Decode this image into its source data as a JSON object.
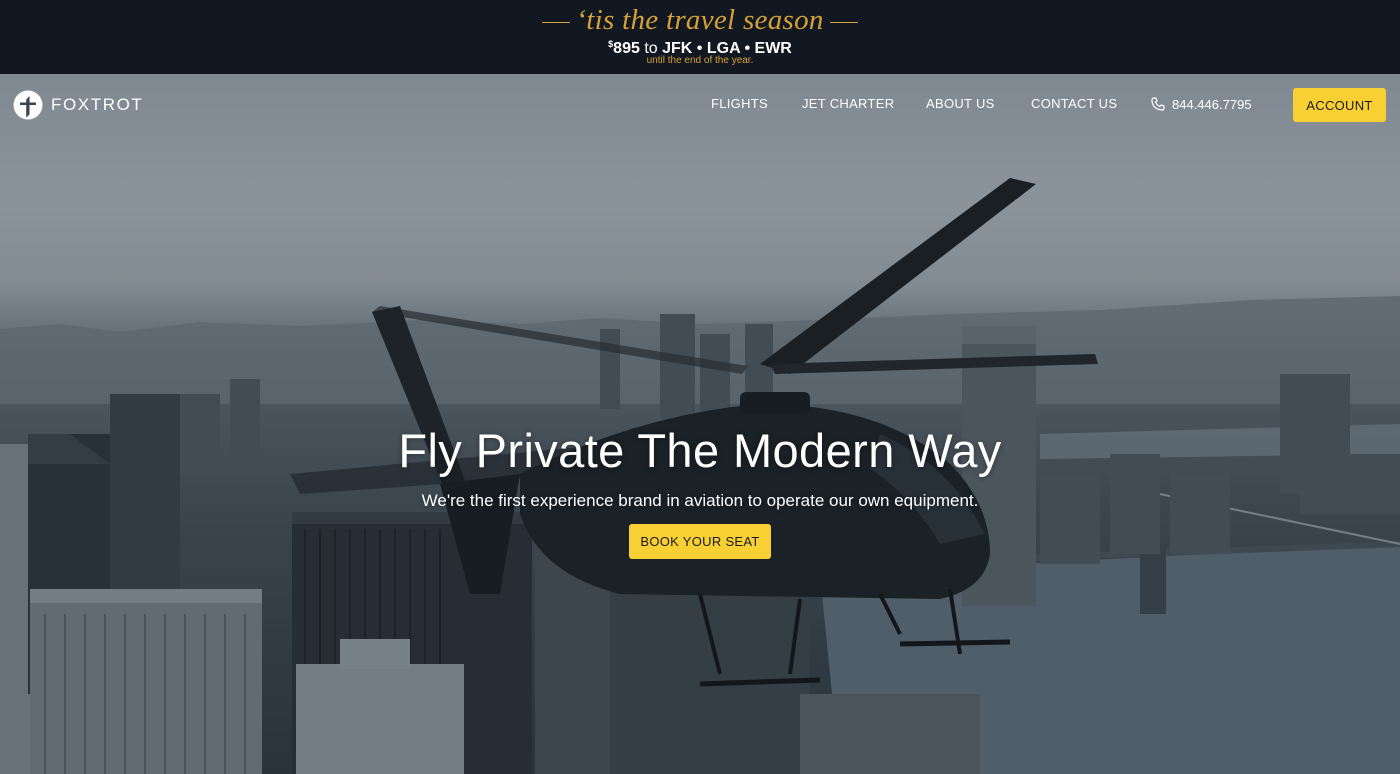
{
  "promo": {
    "headline": "‘tis the travel season",
    "price_symbol": "$",
    "price_value": "895",
    "price_to": "to",
    "routes": "JFK • LGA • EWR",
    "subtext": "until the end of the year."
  },
  "brand": {
    "name": "FOXTROT"
  },
  "nav": {
    "flights": "FLIGHTS",
    "jet_charter": "JET CHARTER",
    "about_us": "ABOUT US",
    "contact_us": "CONTACT US",
    "phone": "844.446.7795",
    "account": "ACCOUNT"
  },
  "hero": {
    "title": "Fly Private The Modern Way",
    "subtitle": "We're the first experience brand in aviation to operate our own equipment.",
    "cta": "BOOK YOUR SEAT"
  },
  "colors": {
    "accent_yellow": "#f9d033",
    "promo_gold": "#d6a136",
    "promo_background": "#111822"
  },
  "icons": {
    "logo": "foxtrot-f-logo-icon",
    "phone": "phone-icon"
  }
}
